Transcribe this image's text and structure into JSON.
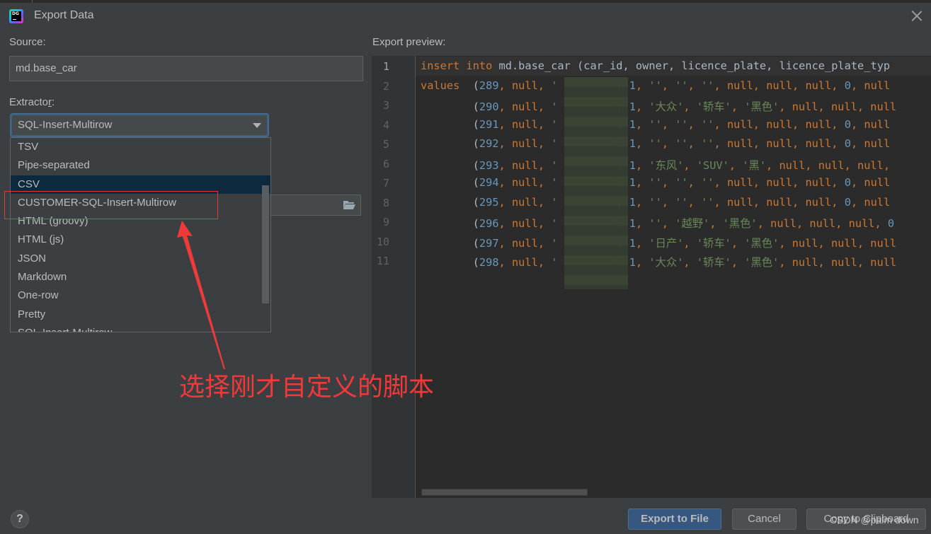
{
  "window": {
    "title": "Export Data",
    "app_icon": "datagrip-logo-icon",
    "close_icon": "close-icon"
  },
  "source": {
    "label": "Source:",
    "value": "md.base_car"
  },
  "extractor": {
    "label_prefix": "Extracto",
    "label_mnemonic": "r",
    "label_suffix": ":",
    "selected": "SQL-Insert-Multirow",
    "options": [
      "TSV",
      "Pipe-separated",
      "CSV",
      "CUSTOMER-SQL-Insert-Multirow",
      "HTML (groovy)",
      "HTML (js)",
      "JSON",
      "Markdown",
      "One-row",
      "Pretty",
      "SQL-Insert-Multirow"
    ],
    "highlighted_option": "CSV"
  },
  "preview": {
    "label": "Export preview:",
    "line_numbers": [
      "1",
      "2",
      "3",
      "4",
      "5",
      "6",
      "7",
      "8",
      "9",
      "10",
      "11"
    ],
    "header_line": {
      "kw1": "insert",
      "kw2": "into",
      "rest": " md.base_car (car_id, owner, licence_plate, licence_plate_typ"
    },
    "values_kw": "values",
    "rows": [
      {
        "id": "289",
        "b": "''",
        "c": "''",
        "d": "''",
        "tail": "null, null, null, 0, null"
      },
      {
        "id": "290",
        "b": "'大众'",
        "c": "'轿车'",
        "d": "'黑色'",
        "tail": "null, null, null"
      },
      {
        "id": "291",
        "b": "''",
        "c": "''",
        "d": "''",
        "tail": "null, null, null, 0, null"
      },
      {
        "id": "292",
        "b": "''",
        "c": "''",
        "d": "''",
        "tail": "null, null, null, 0, null"
      },
      {
        "id": "293",
        "b": "'东风'",
        "c": "'SUV'",
        "d": "'黑'",
        "tail": "null, null, null,"
      },
      {
        "id": "294",
        "b": "''",
        "c": "''",
        "d": "''",
        "tail": "null, null, null, 0, null"
      },
      {
        "id": "295",
        "b": "''",
        "c": "''",
        "d": "''",
        "tail": "null, null, null, 0, null"
      },
      {
        "id": "296",
        "b": "''",
        "c": "'越野'",
        "d": "'黑色'",
        "tail": "null, null, null, 0"
      },
      {
        "id": "297",
        "b": "'日产'",
        "c": "'轿车'",
        "d": "'黑色'",
        "tail": "null, null, null"
      },
      {
        "id": "298",
        "b": "'大众'",
        "c": "'轿车'",
        "d": "'黑色'",
        "tail": "null, null, null"
      }
    ]
  },
  "buttons": {
    "help": "?",
    "export_to_file": "Export to File",
    "cancel": "Cancel",
    "copy_to_clipboard": "Copy to Clipboard"
  },
  "annotation": {
    "text": "选择刚才自定义的脚本",
    "color": "#f03a3a"
  },
  "watermark": "CSDN @palm down",
  "colors": {
    "background": "#3c3f41",
    "editor_bg": "#2b2b2b",
    "keyword": "#cc7832",
    "number": "#6897bb",
    "string": "#6a8759",
    "primary_button": "#365880",
    "selection": "#0d293e"
  }
}
